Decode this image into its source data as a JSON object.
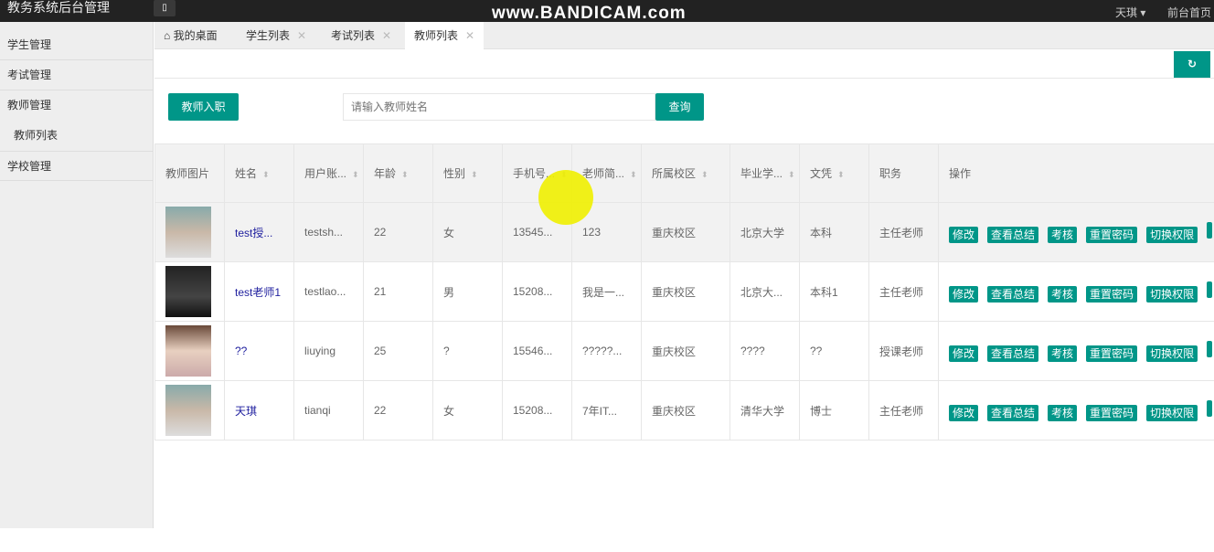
{
  "app": {
    "title": "教务系统后台管理",
    "watermark": "www.BANDICAM.com",
    "user": "天琪",
    "front_link": "前台首页"
  },
  "sidebar": {
    "items": [
      {
        "label": "学生管理"
      },
      {
        "label": "考试管理"
      },
      {
        "label": "教师管理"
      },
      {
        "label": "教师列表"
      },
      {
        "label": "学校管理"
      }
    ]
  },
  "tabs": [
    {
      "label": "我的桌面"
    },
    {
      "label": "学生列表"
    },
    {
      "label": "考试列表"
    },
    {
      "label": "教师列表"
    }
  ],
  "toolbar": {
    "add_label": "教师入职",
    "search_placeholder": "请输入教师姓名",
    "search_label": "查询",
    "refresh_icon": "refresh-icon"
  },
  "table": {
    "headers": [
      "教师图片",
      "姓名",
      "用户账...",
      "年龄",
      "性别",
      "手机号...",
      "老师简...",
      "所属校区",
      "毕业学...",
      "文凭",
      "职务",
      "操作"
    ],
    "actions": [
      "修改",
      "查看总结",
      "考核",
      "重置密码",
      "切换权限"
    ],
    "rows": [
      {
        "name": "test授...",
        "account": "testsh...",
        "age": "22",
        "gender": "女",
        "phone": "13545...",
        "intro": "123",
        "campus": "重庆校区",
        "school": "北京大学",
        "degree": "本科",
        "role": "主任老师"
      },
      {
        "name": "test老师1",
        "account": "testlao...",
        "age": "21",
        "gender": "男",
        "phone": "15208...",
        "intro": "我是一...",
        "campus": "重庆校区",
        "school": "北京大...",
        "degree": "本科1",
        "role": "主任老师"
      },
      {
        "name": "??",
        "account": "liuying",
        "age": "25",
        "gender": "?",
        "phone": "15546...",
        "intro": "?????...",
        "campus": "重庆校区",
        "school": "????",
        "degree": "??",
        "role": "授课老师"
      },
      {
        "name": "天琪",
        "account": "tianqi",
        "age": "22",
        "gender": "女",
        "phone": "15208...",
        "intro": "7年IT...",
        "campus": "重庆校区",
        "school": "清华大学",
        "degree": "博士",
        "role": "主任老师"
      }
    ]
  },
  "colors": {
    "accent": "#009688",
    "topbar": "#222222"
  }
}
